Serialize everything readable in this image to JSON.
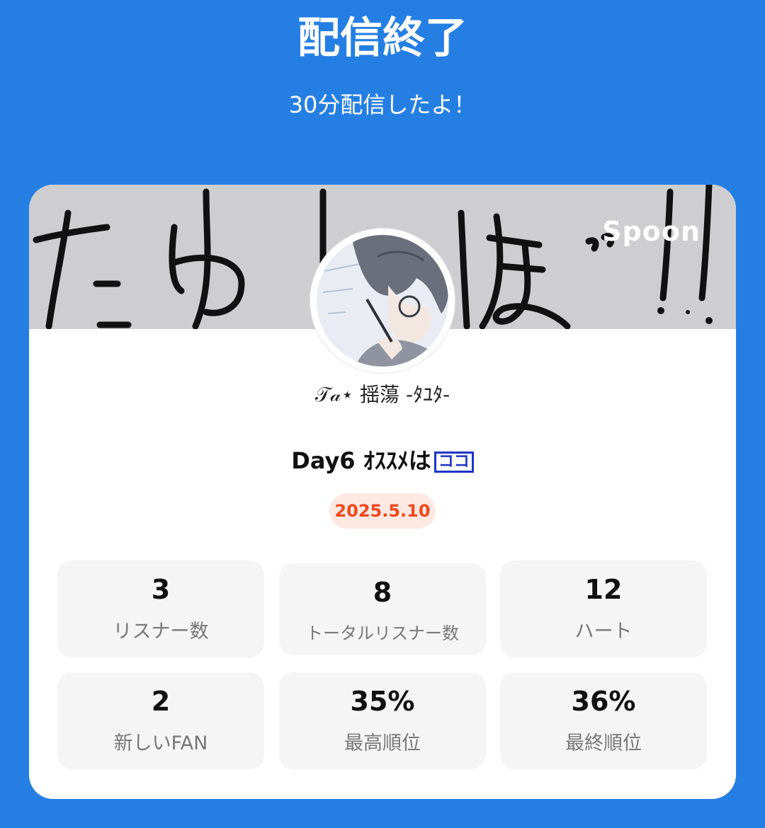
{
  "header": {
    "title": "配信終了",
    "subtitle": "30分配信したよ！"
  },
  "card": {
    "banner": {
      "brand": "Spoon",
      "handwriting": "たゆトリほ゛!!"
    },
    "host_name": "𝒯𝒶⋆ 揺蕩 -ﾀﾕﾀ-",
    "live_title": "Day6 ｵｽｽﾒは",
    "live_title_tag": "ココ",
    "date": "2025.5.10",
    "stats": [
      {
        "value": "3",
        "label": "リスナー数"
      },
      {
        "value": "8",
        "label": "トータルリスナー数"
      },
      {
        "value": "12",
        "label": "ハート"
      },
      {
        "value": "2",
        "label": "新しいFAN"
      },
      {
        "value": "35%",
        "label": "最高順位"
      },
      {
        "value": "36%",
        "label": "最終順位"
      }
    ]
  },
  "colors": {
    "background": "#257fe3",
    "card": "#ffffff",
    "banner": "#cecdcf",
    "date_text": "#f0481e",
    "date_bg": "#fde9e2",
    "stat_bg": "#f5f5f5"
  }
}
